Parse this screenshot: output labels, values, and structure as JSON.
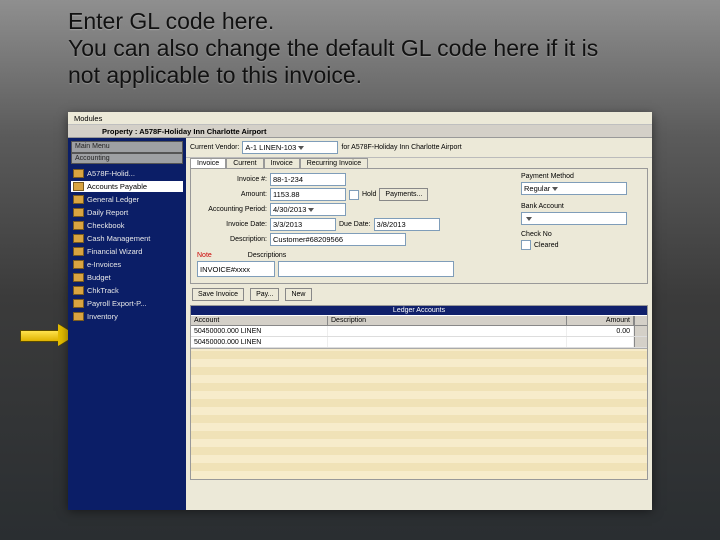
{
  "caption_line1": "Enter GL code here.",
  "caption_line2": "You can also change the default GL code here if it is not applicable to this invoice.",
  "menubar": [
    "Modules"
  ],
  "window_title": "Property : A578F-Holiday Inn Charlotte Airport",
  "sidebar": {
    "vtabs": [
      "Main Menu",
      "Accounting"
    ],
    "items": [
      {
        "label": "A578F-Holid..."
      },
      {
        "label": "Accounts Payable",
        "selected": true
      },
      {
        "label": "General Ledger"
      },
      {
        "label": "Daily Report"
      },
      {
        "label": "Checkbook"
      },
      {
        "label": "Cash Management"
      },
      {
        "label": "Financial Wizard"
      },
      {
        "label": "e-Invoices"
      },
      {
        "label": "Budget"
      },
      {
        "label": "ChkTrack"
      },
      {
        "label": "Payroll Export-P..."
      },
      {
        "label": "Inventory"
      }
    ]
  },
  "vendor_row": {
    "label": "Current Vendor:",
    "value": "A-1 LINEN-103",
    "for_label": "for A578F-Holiday Inn Charlotte Airport"
  },
  "tabs": [
    "Invoice",
    "Current",
    "Invoice",
    "Recurring Invoice"
  ],
  "form": {
    "invoice_no_label": "Invoice #:",
    "invoice_no": "88-1-234",
    "amount_label": "Amount:",
    "amount": "1153.88",
    "period_label": "Accounting Period:",
    "period": "4/30/2013",
    "invoice_date_label": "Invoice Date:",
    "invoice_date": "3/3/2013",
    "due_date_label": "Due Date:",
    "due_date": "3/8/2013",
    "desc_label": "Description:",
    "desc": "Customer#68209566",
    "hold_label": "Hold",
    "payments_label": "Payments...",
    "payment_method_label": "Payment Method",
    "payment_method": "Regular",
    "bank_acct_label": "Bank Account",
    "bank_acct": "",
    "check_no_label": "Check No",
    "cleared_label": "Cleared",
    "note_label": "Note",
    "descriptions_label": "Descriptions",
    "note_value": "INVOICE#xxxx"
  },
  "action_buttons": {
    "save": "Save Invoice",
    "pay": "Pay...",
    "new": "New"
  },
  "ledger": {
    "title": "Ledger Accounts",
    "cols": {
      "account": "Account",
      "description": "Description",
      "amount": "Amount"
    },
    "rows": [
      {
        "account": "50450000.000 LINEN",
        "description": "",
        "amount": "0.00"
      },
      {
        "account": "50450000.000 LINEN",
        "description": "",
        "amount": ""
      }
    ]
  }
}
